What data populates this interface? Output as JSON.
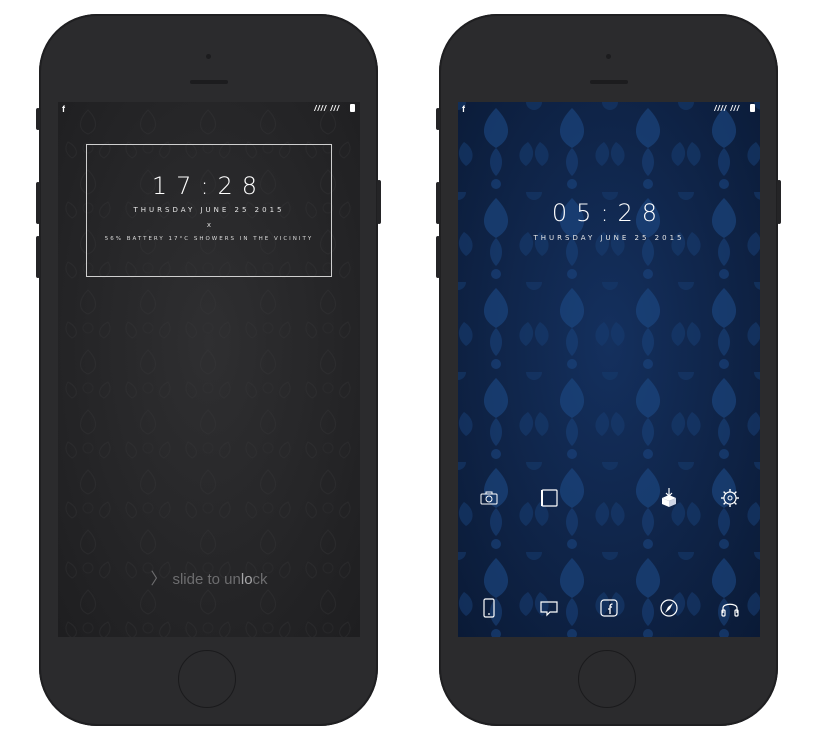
{
  "left_phone": {
    "status": {
      "fb": "f",
      "signal": "//// ///"
    },
    "clock": {
      "time": "17:28",
      "date": "THURSDAY JUNE 25 2015",
      "separator": "x",
      "info": "56% BATTERY 17°C SHOWERS IN THE VICINITY"
    },
    "slide": {
      "prefix": "slide to un",
      "highlight": "lo",
      "suffix": "ck"
    }
  },
  "right_phone": {
    "status": {
      "fb": "f",
      "signal": "//// ///"
    },
    "clock": {
      "time": "05:28",
      "date": "THURSDAY JUNE 25 2015"
    },
    "row1_icons": [
      "camera-icon",
      "notes-icon",
      "cydia-box-icon",
      "settings-gear-icon"
    ],
    "dock_icons": [
      "phone-icon",
      "messages-icon",
      "facebook-icon",
      "safari-compass-icon",
      "music-headphones-icon"
    ]
  },
  "colors": {
    "phone_body": "#2b2b2d",
    "dark_screen": "#262628",
    "blue_screen": "#0f2448",
    "text": "#ffffff"
  }
}
